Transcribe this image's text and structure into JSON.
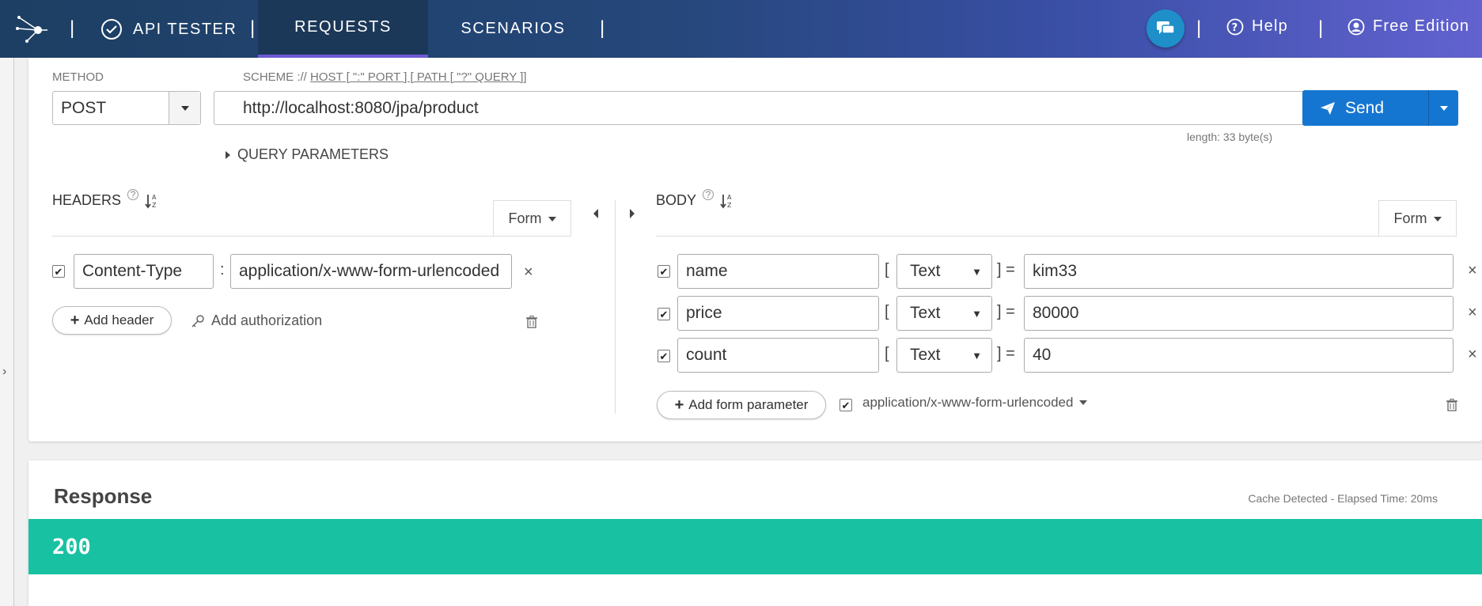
{
  "nav": {
    "brand_label": "API TESTER",
    "tabs": [
      "REQUESTS",
      "SCENARIOS"
    ],
    "help_label": "Help",
    "edition_label": "Free Edition"
  },
  "request": {
    "method_label": "METHOD",
    "method_value": "POST",
    "scheme_hint_prefix": "SCHEME :// ",
    "scheme_hint_link": "HOST [ \":\" PORT ] [ PATH [ \"?\" QUERY ]]",
    "url": "http://localhost:8080/jpa/product",
    "length_text": "length: 33 byte(s)",
    "send_label": "Send",
    "query_params_label": "QUERY PARAMETERS"
  },
  "headers": {
    "title": "HEADERS",
    "form_label": "Form",
    "rows": [
      {
        "name": "Content-Type",
        "value": "application/x-www-form-urlencoded"
      }
    ],
    "add_header_label": "Add header",
    "add_auth_label": "Add authorization"
  },
  "body": {
    "title": "BODY",
    "form_label": "Form",
    "rows": [
      {
        "name": "name",
        "type": "Text",
        "value": "kim33"
      },
      {
        "name": "price",
        "type": "Text",
        "value": "80000"
      },
      {
        "name": "count",
        "type": "Text",
        "value": "40"
      }
    ],
    "add_param_label": "Add form parameter",
    "content_type": "application/x-www-form-urlencoded"
  },
  "response": {
    "title": "Response",
    "meta": "Cache Detected - Elapsed Time: 20ms",
    "status_code": "200",
    "status_color": "#18c1a2"
  },
  "colors": {
    "accent": "#1576d1",
    "nav_active": "#1c3858"
  },
  "icons": [
    "logo-icon",
    "check-badge-icon",
    "chat-icon",
    "help-circle-icon",
    "user-icon",
    "paper-plane-icon",
    "sort-az-icon",
    "trash-icon",
    "key-icon",
    "close-icon"
  ]
}
